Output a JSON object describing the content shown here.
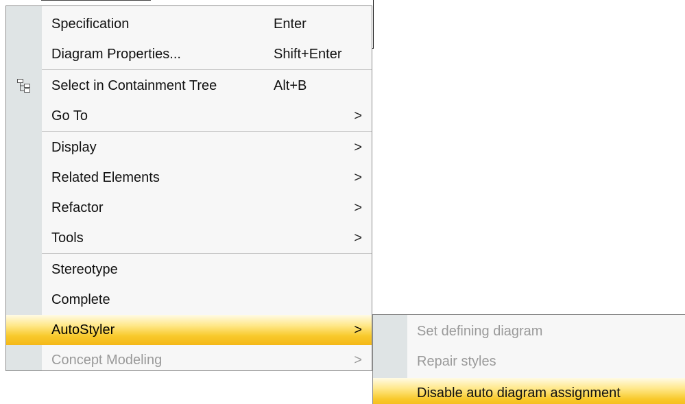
{
  "context_menu": {
    "items": [
      {
        "label": "Specification",
        "shortcut": "Enter",
        "arrow": "",
        "icon": ""
      },
      {
        "label": "Diagram Properties...",
        "shortcut": "Shift+Enter",
        "arrow": "",
        "icon": ""
      },
      {
        "label": "Select in Containment Tree",
        "shortcut": "Alt+B",
        "arrow": "",
        "icon": "containment-tree-icon"
      },
      {
        "label": "Go To",
        "shortcut": "",
        "arrow": ">",
        "icon": ""
      },
      {
        "label": "Display",
        "shortcut": "",
        "arrow": ">",
        "icon": ""
      },
      {
        "label": "Related Elements",
        "shortcut": "",
        "arrow": ">",
        "icon": ""
      },
      {
        "label": "Refactor",
        "shortcut": "",
        "arrow": ">",
        "icon": ""
      },
      {
        "label": "Tools",
        "shortcut": "",
        "arrow": ">",
        "icon": ""
      },
      {
        "label": "Stereotype",
        "shortcut": "",
        "arrow": "",
        "icon": ""
      },
      {
        "label": "Complete",
        "shortcut": "",
        "arrow": "",
        "icon": ""
      },
      {
        "label": "AutoStyler",
        "shortcut": "",
        "arrow": ">",
        "icon": "",
        "state": "highlighted"
      },
      {
        "label": "Concept Modeling",
        "shortcut": "",
        "arrow": ">",
        "icon": "",
        "state": "disabled"
      }
    ]
  },
  "autostyler_submenu": {
    "items": [
      {
        "label": "Set defining diagram",
        "state": "disabled"
      },
      {
        "label": "Repair styles",
        "state": "disabled"
      },
      {
        "label": "Disable auto diagram assignment",
        "state": "highlighted"
      }
    ]
  },
  "colors": {
    "menu_background": "#f7f7f7",
    "gutter": "#dfe4e5",
    "highlight": "#f8c92c",
    "disabled_text": "#9a9a9a"
  }
}
